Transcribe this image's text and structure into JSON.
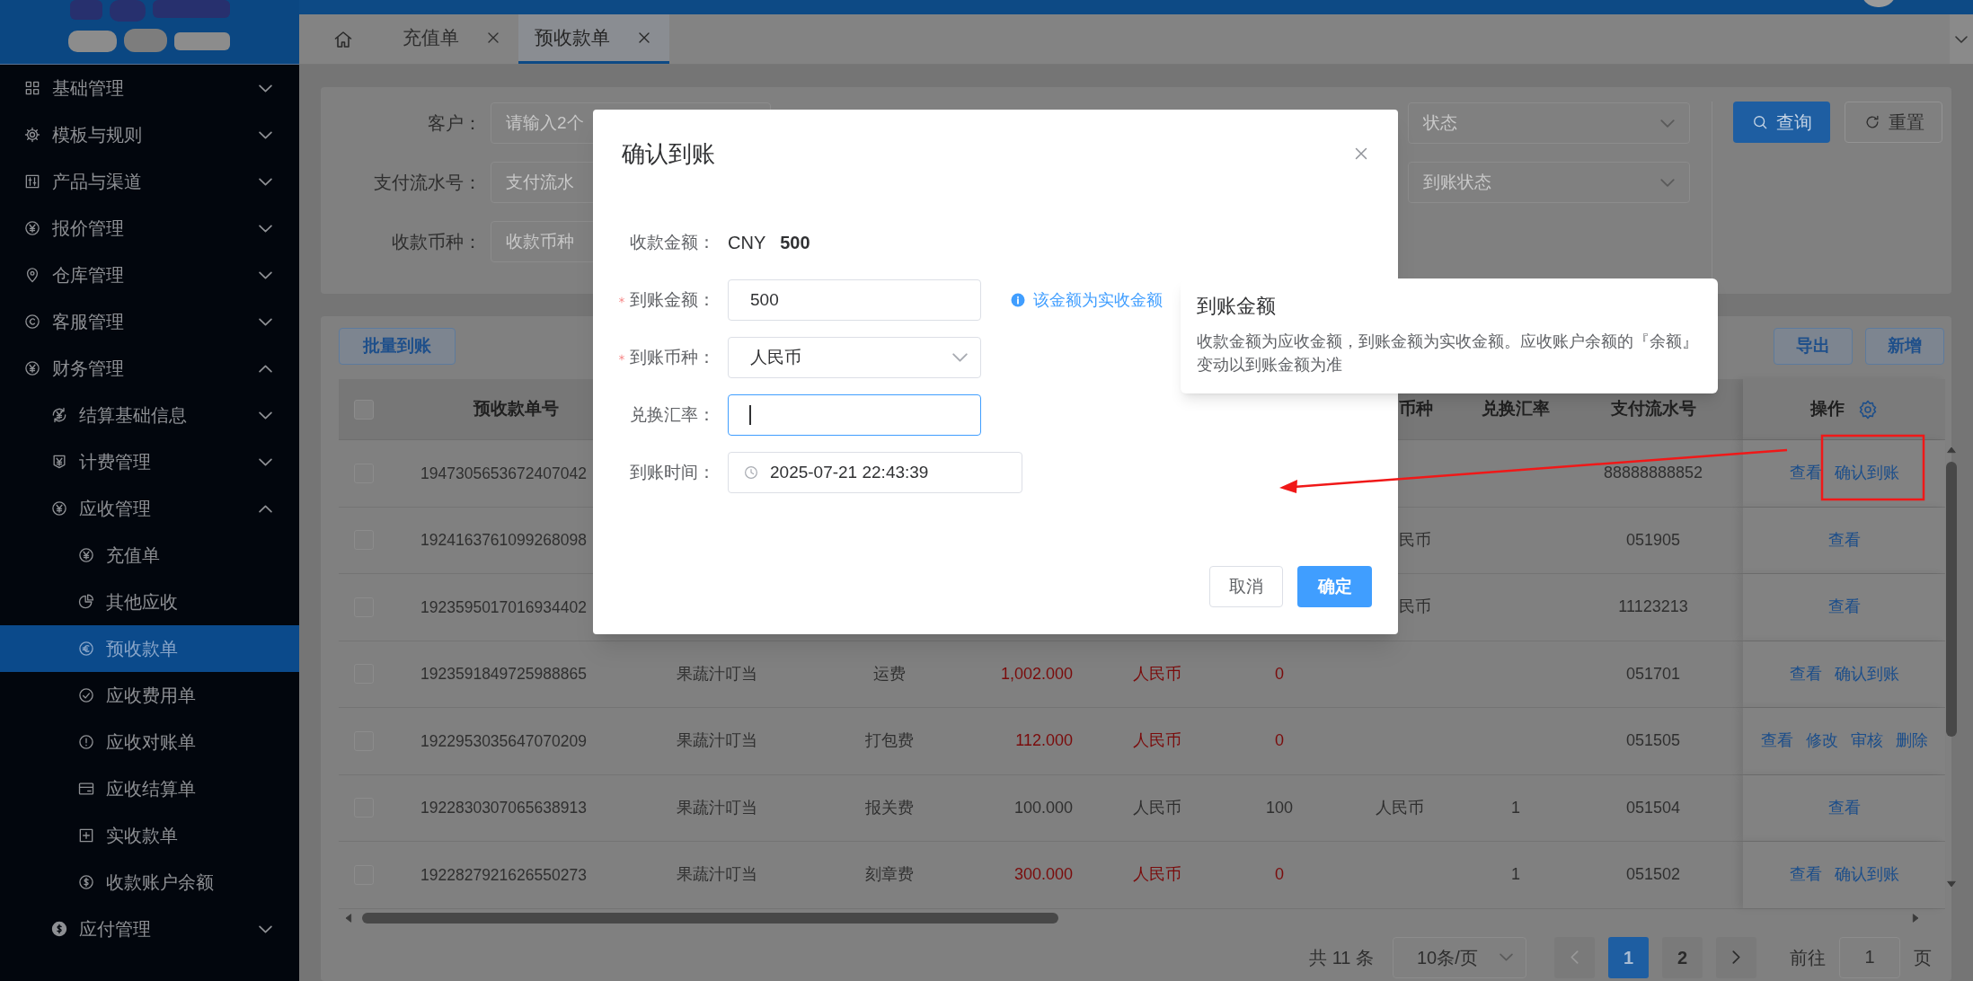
{
  "sidebar": {
    "items": [
      {
        "label": "基础管理",
        "expanded": false
      },
      {
        "label": "模板与规则",
        "expanded": false
      },
      {
        "label": "产品与渠道",
        "expanded": false
      },
      {
        "label": "报价管理",
        "expanded": false
      },
      {
        "label": "仓库管理",
        "expanded": false
      },
      {
        "label": "客服管理",
        "expanded": false
      },
      {
        "label": "财务管理",
        "expanded": true,
        "children": [
          {
            "label": "结算基础信息",
            "expanded": false
          },
          {
            "label": "计费管理",
            "expanded": false
          },
          {
            "label": "应收管理",
            "expanded": true,
            "children": [
              {
                "label": "充值单",
                "selected": false
              },
              {
                "label": "其他应收",
                "selected": false
              },
              {
                "label": "预收款单",
                "selected": true
              },
              {
                "label": "应收费用单",
                "selected": false
              },
              {
                "label": "应收对账单",
                "selected": false
              },
              {
                "label": "应收结算单",
                "selected": false
              },
              {
                "label": "实收款单",
                "selected": false
              },
              {
                "label": "收款账户余额",
                "selected": false
              }
            ]
          },
          {
            "label": "应付管理",
            "expanded": false
          }
        ]
      }
    ]
  },
  "tabs": [
    {
      "label": "充值单",
      "selected": false
    },
    {
      "label": "预收款单",
      "selected": true
    }
  ],
  "filter": {
    "fields": [
      {
        "label": "客户：",
        "placeholder": "请输入2个"
      },
      {
        "label": "支付流水号：",
        "placeholder": "支付流水"
      },
      {
        "label": "收款币种：",
        "placeholder": "收款币种"
      }
    ],
    "selects": [
      {
        "placeholder": "状态"
      },
      {
        "placeholder": "到账状态"
      }
    ],
    "buttons": [
      {
        "label": "查询",
        "primary": true
      },
      {
        "label": "重置",
        "primary": false
      }
    ]
  },
  "table": {
    "left_buttons": [
      "批量到账"
    ],
    "right_buttons": [
      "导出",
      "新增"
    ],
    "header": {
      "all_checked": false,
      "order_no": "预收款单号",
      "column_7": "币种",
      "exchange_rate": "兑换汇率",
      "payment_serial": "支付流水号",
      "actions": "操作"
    },
    "rows": [
      {
        "checked": false,
        "order_no": "1947305653672407042",
        "payment_serial": "88888888852",
        "actions": [
          "查看",
          "确认到账"
        ]
      },
      {
        "checked": false,
        "order_no": "1924163761099268098",
        "column_7": "民币",
        "payment_serial": "051905",
        "actions": [
          "查看"
        ]
      },
      {
        "checked": false,
        "order_no": "1923595017016934402",
        "column_7": "民币",
        "payment_serial": "11123213",
        "actions": [
          "查看"
        ]
      },
      {
        "checked": false,
        "order_no": "1923591849725988865",
        "column_2": "果蔬汁叮当",
        "column_3": "运费",
        "column_4": "1,002.000",
        "column_5": "人民币",
        "column_6": "0",
        "alert": true,
        "payment_serial": "051701",
        "actions": [
          "查看",
          "确认到账"
        ]
      },
      {
        "checked": false,
        "order_no": "1922953035647070209",
        "column_2": "果蔬汁叮当",
        "column_3": "打包费",
        "column_4": "112.000",
        "column_5": "人民币",
        "column_6": "0",
        "alert": true,
        "payment_serial": "051505",
        "actions": [
          "查看",
          "修改",
          "审核",
          "删除"
        ]
      },
      {
        "checked": false,
        "order_no": "1922830307065638913",
        "column_2": "果蔬汁叮当",
        "column_3": "报关费",
        "column_4": "100.000",
        "column_5": "人民币",
        "column_6": "100",
        "alert": false,
        "column_7": "人民币",
        "exchange_rate": "1",
        "payment_serial": "051504",
        "actions": [
          "查看"
        ]
      },
      {
        "checked": false,
        "order_no": "1922827921626550273",
        "column_2": "果蔬汁叮当",
        "column_3": "刻章费",
        "column_4": "300.000",
        "column_5": "人民币",
        "column_6": "0",
        "alert": true,
        "exchange_rate": "1",
        "payment_serial": "051502",
        "actions": [
          "查看",
          "确认到账"
        ]
      }
    ]
  },
  "pagination": {
    "total": "共 11 条",
    "page_size": "10条/页",
    "pages": [
      {
        "label": "1",
        "selected": true
      },
      {
        "label": "2",
        "selected": false
      }
    ],
    "goto_label": "前往",
    "goto_value": "1",
    "page_unit": "页"
  },
  "dialog": {
    "title": "确认到账",
    "fields": [
      {
        "kind": "text",
        "label": "收款金额：",
        "currency": "CNY",
        "value": "500"
      },
      {
        "kind": "input",
        "label": "到账金额：",
        "required": true,
        "focused": false,
        "value": "500",
        "hint": "该金额为实收金额"
      },
      {
        "kind": "select",
        "label": "到账币种：",
        "required": true,
        "value": "人民币"
      },
      {
        "kind": "input",
        "label": "兑换汇率：",
        "required": false,
        "focused": true
      },
      {
        "kind": "datetime",
        "label": "到账时间：",
        "required": false,
        "value": "2025-07-21 22:43:39"
      }
    ],
    "buttons": [
      {
        "label": "取消",
        "primary": false
      },
      {
        "label": "确定",
        "primary": true
      }
    ]
  },
  "tooltip": {
    "title": "到账金额",
    "text": "收款金额为应收金额，到账金额为实收金额。应收账户余额的『余额』变动以到账金额为准"
  }
}
